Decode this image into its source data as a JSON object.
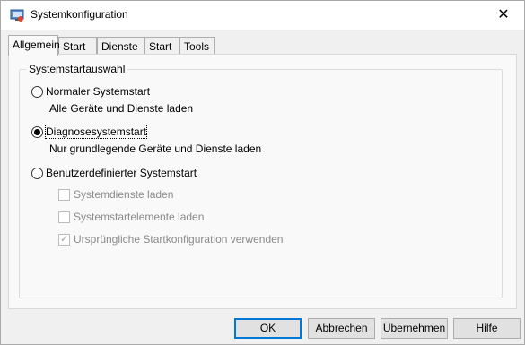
{
  "window": {
    "title": "Systemkonfiguration",
    "close_label": "✕"
  },
  "tabs": [
    "Allgemein",
    "Start",
    "Dienste",
    "Start",
    "Tools"
  ],
  "group": {
    "label": "Systemstartauswahl"
  },
  "options": [
    {
      "label": "Normaler Systemstart",
      "description": "Alle Geräte und Dienste laden",
      "selected": false
    },
    {
      "label": "Diagnosesystemstart",
      "description": "Nur grundlegende Geräte und Dienste laden",
      "selected": true
    },
    {
      "label": "Benutzerdefinierter Systemstart",
      "selected": false
    }
  ],
  "sub_options": [
    {
      "label": "Systemdienste laden",
      "checked": false
    },
    {
      "label": "Systemstartelemente laden",
      "checked": false
    },
    {
      "label": "Ursprüngliche Startkonfiguration verwenden",
      "checked": true
    }
  ],
  "buttons": {
    "ok": "OK",
    "cancel": "Abbrechen",
    "apply": "Übernehmen",
    "help": "Hilfe"
  }
}
